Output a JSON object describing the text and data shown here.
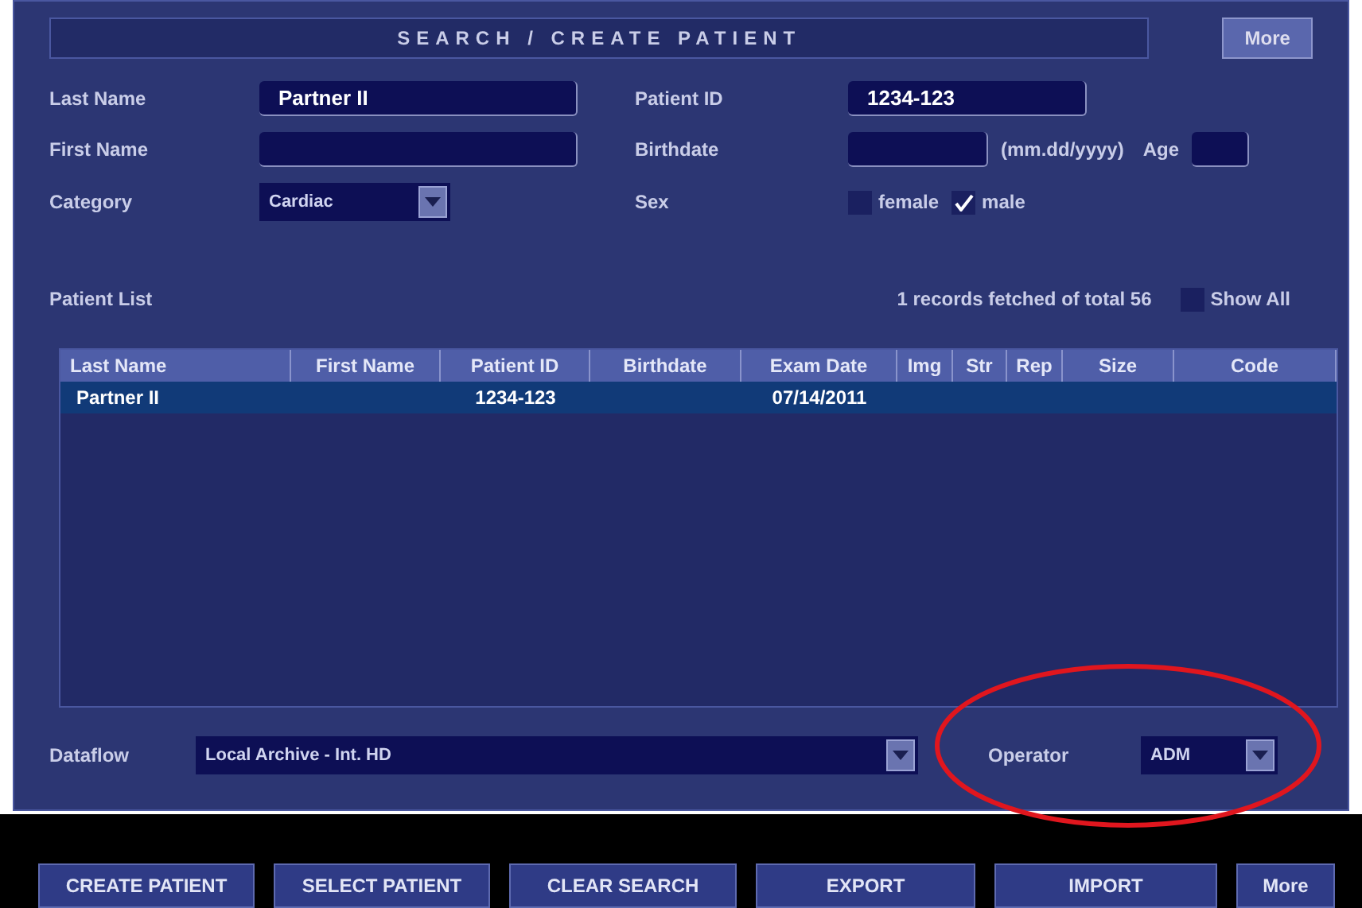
{
  "header": {
    "title": "SEARCH / CREATE PATIENT",
    "more_button": "More"
  },
  "form": {
    "last_name": {
      "label": "Last Name",
      "value": "Partner II"
    },
    "first_name": {
      "label": "First Name"
    },
    "category": {
      "label": "Category",
      "value": "Cardiac"
    },
    "patient_id": {
      "label": "Patient ID",
      "value": "1234-123"
    },
    "birthdate": {
      "label": "Birthdate",
      "hint": "(mm.dd/yyyy)"
    },
    "age": {
      "label": "Age"
    },
    "sex": {
      "label": "Sex",
      "options": [
        {
          "label": "female",
          "checked": false
        },
        {
          "label": "male",
          "checked": true
        }
      ]
    }
  },
  "patient_list": {
    "label": "Patient List",
    "summary": "1 records fetched of total 56",
    "show_all": {
      "label": "Show All",
      "checked": false
    }
  },
  "table": {
    "columns": [
      "Last Name",
      "First Name",
      "Patient ID",
      "Birthdate",
      "Exam Date",
      "Img",
      "Str",
      "Rep",
      "Size",
      "Code"
    ],
    "rows": [
      {
        "selected": true,
        "cells": [
          "Partner II",
          null,
          "1234-123",
          null,
          "07/14/2011"
        ]
      }
    ]
  },
  "dataflow": {
    "label": "Dataflow",
    "value": "Local Archive - Int. HD"
  },
  "operator": {
    "label": "Operator",
    "value": "ADM"
  },
  "buttons": [
    "CREATE PATIENT",
    "SELECT PATIENT",
    "CLEAR SEARCH",
    "EXPORT",
    "IMPORT",
    "More"
  ]
}
